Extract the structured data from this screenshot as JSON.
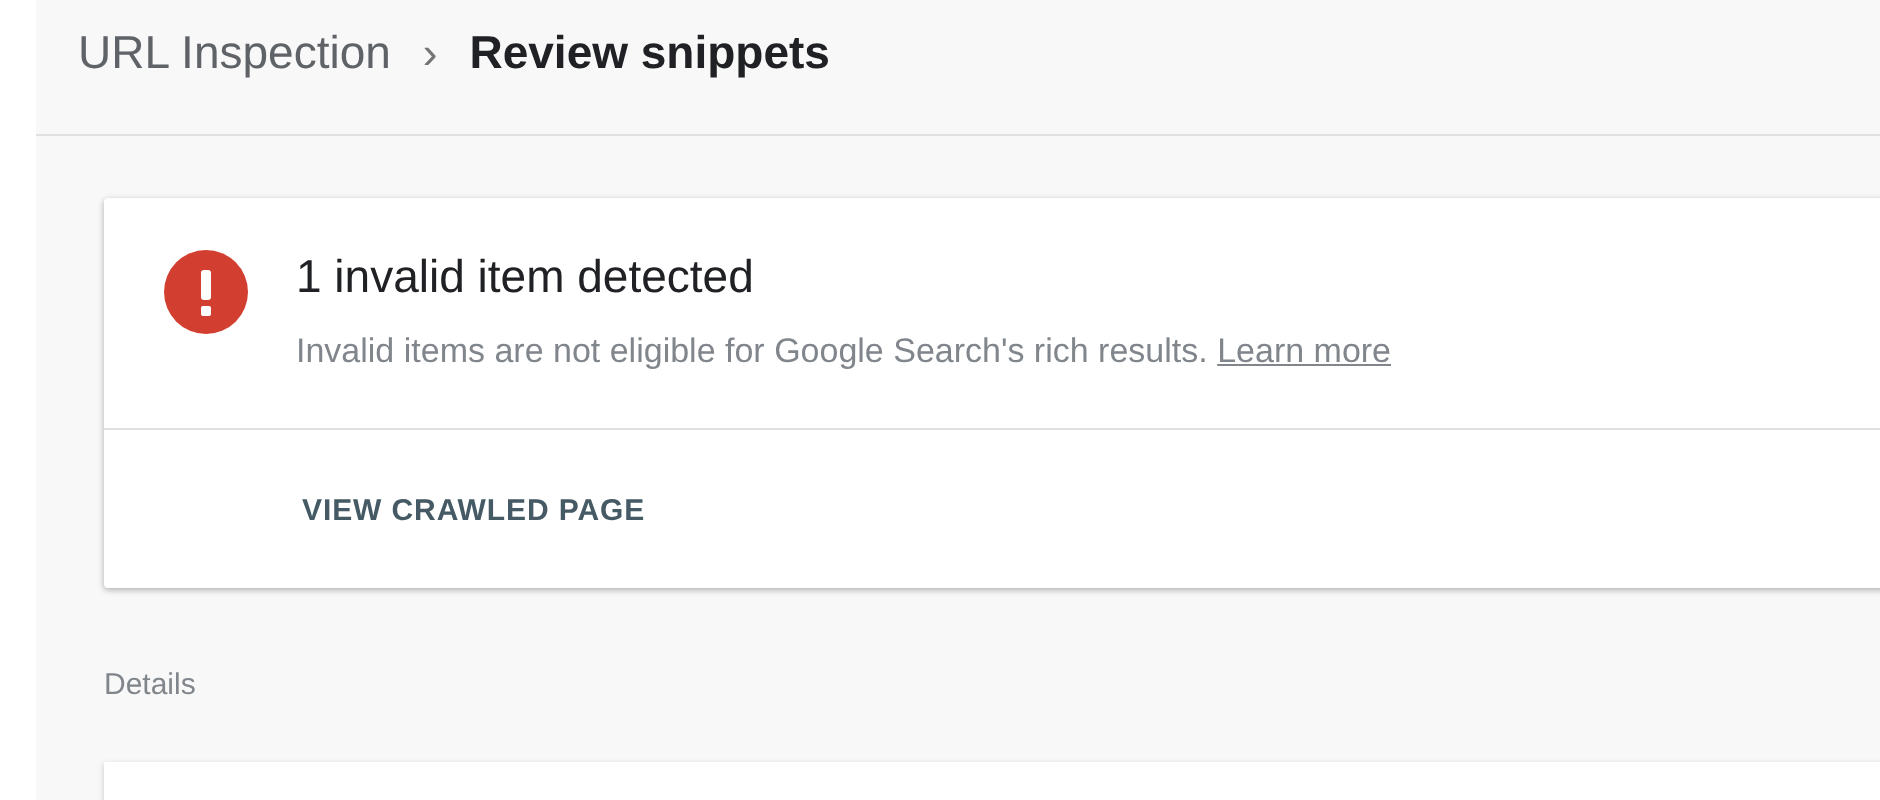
{
  "breadcrumb": {
    "parent": "URL Inspection",
    "separator": "›",
    "current": "Review snippets"
  },
  "alert": {
    "error": true,
    "title": "1 invalid item detected",
    "message": "Invalid items are not eligible for Google Search's rich results.",
    "link": "Learn more",
    "action": "VIEW CRAWLED PAGE"
  },
  "details": {
    "heading": "Details"
  }
}
